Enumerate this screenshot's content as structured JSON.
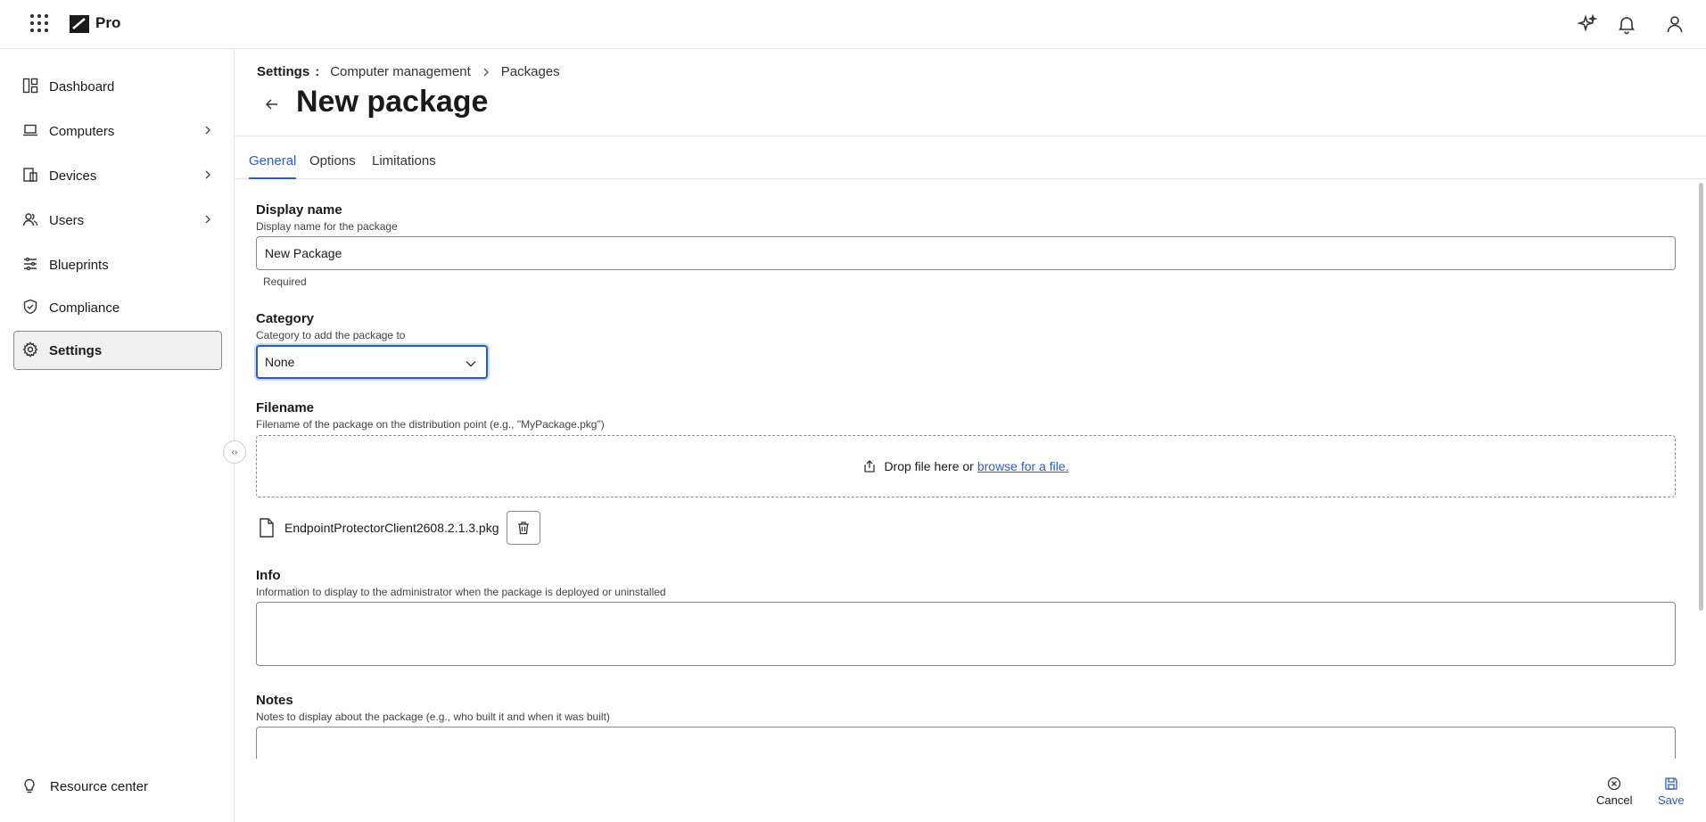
{
  "app": {
    "brand": "Pro"
  },
  "topbar": {
    "icons": [
      "apps-grid-icon",
      "sparkle-ai-icon",
      "bell-icon",
      "user-icon"
    ]
  },
  "sidebar": {
    "items": [
      {
        "label": "Dashboard",
        "icon": "dashboard-icon",
        "has_children": false,
        "active": false
      },
      {
        "label": "Computers",
        "icon": "laptop-icon",
        "has_children": true,
        "active": false
      },
      {
        "label": "Devices",
        "icon": "devices-icon",
        "has_children": true,
        "active": false
      },
      {
        "label": "Users",
        "icon": "users-icon",
        "has_children": true,
        "active": false
      },
      {
        "label": "Blueprints",
        "icon": "sliders-icon",
        "has_children": false,
        "active": false
      },
      {
        "label": "Compliance",
        "icon": "shield-check-icon",
        "has_children": false,
        "active": false
      },
      {
        "label": "Settings",
        "icon": "gear-icon",
        "has_children": false,
        "active": true
      }
    ],
    "resource_center": "Resource center"
  },
  "breadcrumb": {
    "root": "Settings",
    "sep": ":",
    "items": [
      "Computer management",
      "Packages"
    ]
  },
  "page": {
    "title": "New package"
  },
  "tabs": [
    {
      "label": "General",
      "active": true
    },
    {
      "label": "Options",
      "active": false
    },
    {
      "label": "Limitations",
      "active": false
    }
  ],
  "form": {
    "display_name": {
      "label": "Display name",
      "description": "Display name for the package",
      "value": "New Package",
      "helper": "Required"
    },
    "category": {
      "label": "Category",
      "description": "Category to add the package to",
      "value": "None"
    },
    "filename": {
      "label": "Filename",
      "description": "Filename of the package on the distribution point (e.g., \"MyPackage.pkg\")",
      "drop_text": "Drop file here or",
      "browse_text": "browse for a file.",
      "file": "EndpointProtectorClient2608.2.1.3.pkg"
    },
    "info": {
      "label": "Info",
      "description": "Information to display to the administrator when the package is deployed or uninstalled",
      "value": ""
    },
    "notes": {
      "label": "Notes",
      "description": "Notes to display about the package (e.g., who built it and when it was built)",
      "value": ""
    }
  },
  "footer": {
    "cancel": "Cancel",
    "save": "Save"
  },
  "colors": {
    "accent": "#2b5cbf",
    "border": "#8a8a8a",
    "active_bg": "#f0f0f0"
  }
}
